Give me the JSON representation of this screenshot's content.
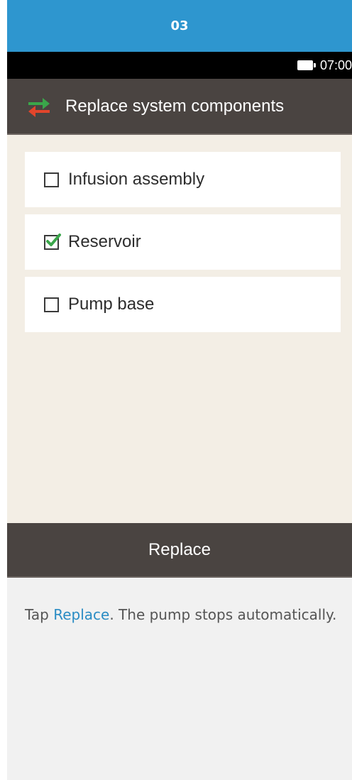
{
  "step": {
    "number": "03"
  },
  "status_bar": {
    "time": "07:00",
    "battery_icon": "battery-icon"
  },
  "title_bar": {
    "title": "Replace system components",
    "icon": "swap-arrows-icon",
    "colors": {
      "up_arrow": "#3aa64a",
      "down_arrow": "#e2452b"
    }
  },
  "components": [
    {
      "label": "Infusion assembly",
      "checked": false
    },
    {
      "label": "Reservoir",
      "checked": true
    },
    {
      "label": "Pump base",
      "checked": false
    }
  ],
  "action": {
    "label": "Replace"
  },
  "instruction": {
    "prefix": "Tap ",
    "link": "Replace",
    "suffix": ". The pump stops automatically."
  },
  "colors": {
    "header_blue": "#2e96cf",
    "dark_bar": "#4a4441",
    "content_bg": "#f3eee5",
    "check_green": "#3aa64a",
    "link_blue": "#2a8cc4"
  }
}
